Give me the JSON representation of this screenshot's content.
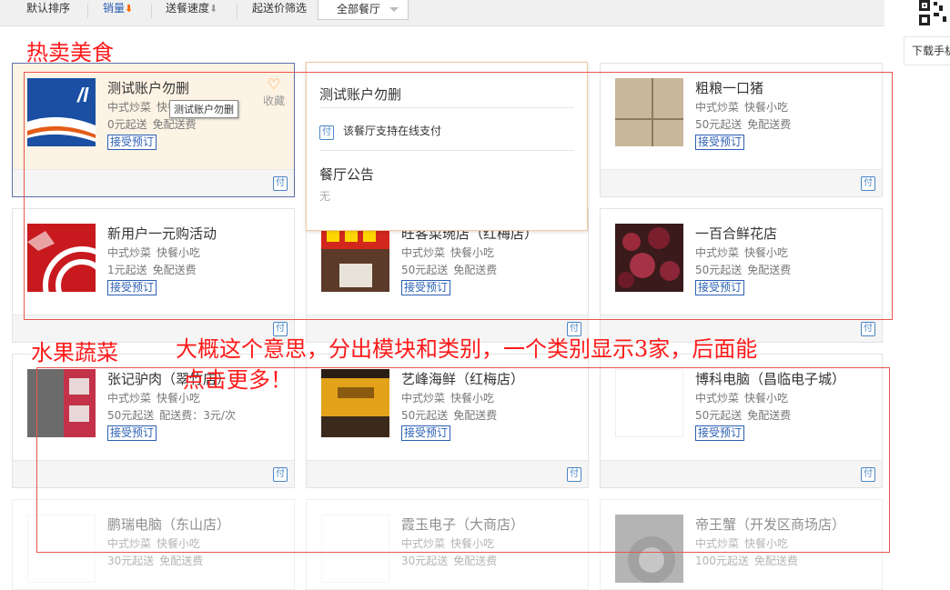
{
  "sort_bar": {
    "items": [
      {
        "label": "默认排序"
      },
      {
        "label": "销量",
        "arrow": "⬇"
      },
      {
        "label": "送餐速度",
        "arrow": "⬇"
      },
      {
        "label": "起送价筛选"
      }
    ],
    "filter_select": "全部餐厅"
  },
  "side": {
    "download_label": "下载手机"
  },
  "annotations": {
    "hot_food": "热卖美食",
    "fruit_veg": "水果蔬菜",
    "note_line1": "大概这个意思，分出模块和类别，一个类别显示3家，后面能",
    "note_line2": "点击更多！"
  },
  "cards": [
    {
      "name": "测试账户勿删",
      "tags": [
        "中式炒菜",
        "快餐小吃"
      ],
      "min_order": "0元起送",
      "delivery": "免配送费",
      "badge": "接受预订",
      "pay_icon": "付",
      "favorite_label": "收藏",
      "tooltip": "测试账户勿删",
      "thumb": "logo-blue"
    },
    {
      "name": "粗粮一口猪",
      "tags": [
        "中式炒菜",
        "快餐小吃"
      ],
      "min_order": "50元起送",
      "delivery": "免配送费",
      "badge": "接受预订",
      "pay_icon": "付",
      "thumb": "beige"
    },
    {
      "name": "新用户一元购活动",
      "tags": [
        "中式炒菜",
        "快餐小吃"
      ],
      "min_order": "1元起送",
      "delivery": "免配送费",
      "badge": "接受预订",
      "pay_icon": "付",
      "thumb": "red-logo"
    },
    {
      "name": "旺客菜琬店（红梅店）",
      "tags": [
        "中式炒菜",
        "快餐小吃"
      ],
      "min_order": "50元起送",
      "delivery": "免配送费",
      "badge": "接受预订",
      "pay_icon": "付",
      "thumb": "storefront"
    },
    {
      "name": "一百合鲜花店",
      "tags": [
        "中式炒菜",
        "快餐小吃"
      ],
      "min_order": "50元起送",
      "delivery": "免配送费",
      "badge": "接受预订",
      "pay_icon": "付",
      "thumb": "flowers"
    },
    {
      "name": "张记驴肉（翠竹店）",
      "tags": [
        "中式炒菜",
        "快餐小吃"
      ],
      "min_order": "50元起送",
      "delivery": "配送费：3元/次",
      "badge": "接受预订",
      "pay_icon": "付",
      "thumb": "red-boxes"
    },
    {
      "name": "艺峰海鲜（红梅店）",
      "tags": [
        "中式炒菜",
        "快餐小吃"
      ],
      "min_order": "50元起送",
      "delivery": "免配送费",
      "badge": "接受预订",
      "pay_icon": "付",
      "thumb": "seafood"
    },
    {
      "name": "博科电脑（昌临电子城）",
      "tags": [
        "中式炒菜",
        "快餐小吃"
      ],
      "min_order": "50元起送",
      "delivery": "免配送费",
      "badge": "接受预订",
      "pay_icon": "付",
      "thumb": "blank"
    },
    {
      "name": "鹏瑞电脑（东山店）",
      "tags": [
        "中式炒菜",
        "快餐小吃"
      ],
      "min_order": "30元起送",
      "delivery": "免配送费",
      "thumb": "blank"
    },
    {
      "name": "霞玉电子（大商店）",
      "tags": [
        "中式炒菜",
        "快餐小吃"
      ],
      "min_order": "30元起送",
      "delivery": "免配送费",
      "thumb": "blank"
    },
    {
      "name": "帝王蟹（开发区商场店）",
      "tags": [
        "中式炒菜",
        "快餐小吃"
      ],
      "min_order": "100元起送",
      "delivery": "免配送费",
      "thumb": "gray"
    }
  ],
  "popup": {
    "title": "测试账户勿删",
    "online_icon": "付",
    "online_text": "该餐厅支持在线支付",
    "notice_title": "餐厅公告",
    "notice_text": "无"
  },
  "colors": {
    "accent_blue": "#2b5fb3",
    "sales_arrow": "#ff6600",
    "annotation_red": "#ff1a1a"
  }
}
